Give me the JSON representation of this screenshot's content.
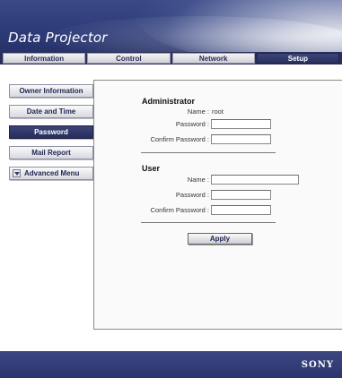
{
  "header": {
    "title": "Data Projector"
  },
  "tabs": [
    {
      "label": "Information",
      "active": false
    },
    {
      "label": "Control",
      "active": false
    },
    {
      "label": "Network",
      "active": false
    },
    {
      "label": "Setup",
      "active": true
    }
  ],
  "sidebar": {
    "items": [
      {
        "label": "Owner Information"
      },
      {
        "label": "Date and Time"
      },
      {
        "label": "Password"
      },
      {
        "label": "Mail Report"
      },
      {
        "label": "Advanced Menu"
      }
    ]
  },
  "administrator": {
    "title": "Administrator",
    "name_label": "Name :",
    "name_value": "root",
    "password_label": "Password :",
    "password_value": "",
    "confirm_label": "Confirm Password :",
    "confirm_value": ""
  },
  "user": {
    "title": "User",
    "name_label": "Name :",
    "name_value": "",
    "password_label": "Password :",
    "password_value": "",
    "confirm_label": "Confirm Password :",
    "confirm_value": ""
  },
  "apply_label": "Apply",
  "footer": {
    "brand": "SONY"
  },
  "colors": {
    "accent": "#2d3568",
    "active_tab": "#2b3160"
  }
}
